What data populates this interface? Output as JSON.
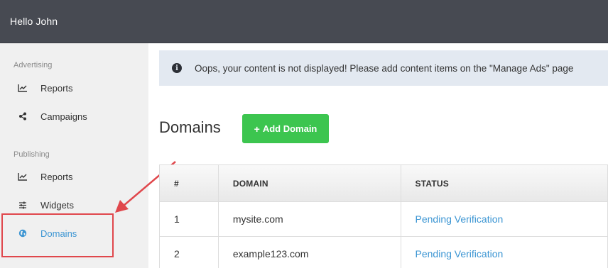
{
  "topbar": {
    "greeting": "Hello John"
  },
  "sidebar": {
    "sections": [
      {
        "title": "Advertising",
        "items": [
          {
            "label": "Reports",
            "icon": "line-chart-icon"
          },
          {
            "label": "Campaigns",
            "icon": "share-icon"
          }
        ]
      },
      {
        "title": "Publishing",
        "items": [
          {
            "label": "Reports",
            "icon": "line-chart-icon"
          },
          {
            "label": "Widgets",
            "icon": "sliders-icon"
          },
          {
            "label": "Domains",
            "icon": "globe-icon",
            "active": true
          }
        ]
      }
    ]
  },
  "alert": {
    "icon": "info-icon",
    "message": "Oops, your content is not displayed! Please add content items on the \"Manage Ads\" page"
  },
  "main": {
    "title": "Domains",
    "add_button": "Add Domain"
  },
  "table": {
    "headers": [
      "#",
      "DOMAIN",
      "STATUS"
    ],
    "rows": [
      {
        "num": "1",
        "domain": "mysite.com",
        "status": "Pending Verification"
      },
      {
        "num": "2",
        "domain": "example123.com",
        "status": "Pending Verification"
      }
    ]
  },
  "colors": {
    "accent": "#3b95d3",
    "add_button": "#3cc54f",
    "highlight": "#e0474c",
    "topbar": "#474a52"
  }
}
